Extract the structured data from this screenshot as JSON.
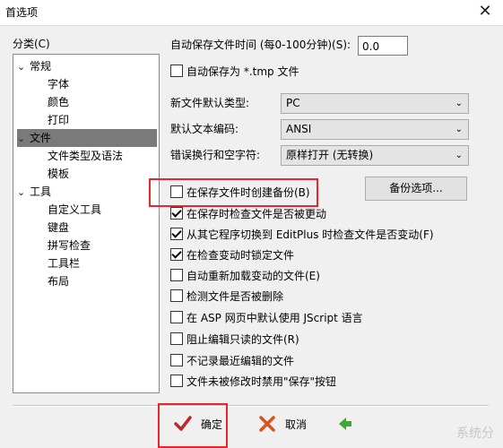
{
  "window": {
    "title": "首选项",
    "close_glyph": "✕"
  },
  "category": {
    "label": "分类(C)",
    "items": [
      {
        "label": "常规",
        "expanded": true
      },
      {
        "label": "字体"
      },
      {
        "label": "颜色"
      },
      {
        "label": "打印"
      },
      {
        "label": "文件",
        "expanded": true,
        "selected": true
      },
      {
        "label": "文件类型及语法"
      },
      {
        "label": "模板"
      },
      {
        "label": "工具",
        "expanded": true
      },
      {
        "label": "自定义工具"
      },
      {
        "label": "键盘"
      },
      {
        "label": "拼写检查"
      },
      {
        "label": "工具栏"
      },
      {
        "label": "布局"
      }
    ]
  },
  "autosave": {
    "label": "自动保存文件时间 (每0-100分钟)(S):",
    "value": "0.0"
  },
  "checkbox_tmp": {
    "label": "自动保存为 *.tmp 文件",
    "checked": false
  },
  "new_file_type": {
    "label": "新文件默认类型:",
    "value": "PC"
  },
  "default_encoding": {
    "label": "默认文本编码:",
    "value": "ANSI"
  },
  "wrap_whitespace": {
    "label": "错误换行和空字符:",
    "value": "原样打开 (无转换)"
  },
  "backup_options_button": "备份选项...",
  "checkboxes": [
    {
      "label": "在保存文件时创建备份(B)",
      "checked": false
    },
    {
      "label": "在保存时检查文件是否被更动",
      "checked": true
    },
    {
      "label": "从其它程序切换到 EditPlus 时检查文件是否变动(F)",
      "checked": true
    },
    {
      "label": "在检查变动时锁定文件",
      "checked": true
    },
    {
      "label": "自动重新加载变动的文件(E)",
      "checked": false
    },
    {
      "label": "检测文件是否被删除",
      "checked": false
    },
    {
      "label": "在 ASP 网页中默认使用 JScript 语言",
      "checked": false
    },
    {
      "label": "阻止编辑只读的文件(R)",
      "checked": false
    },
    {
      "label": "不记录最近编辑的文件",
      "checked": false
    },
    {
      "label": "文件未被修改时禁用\"保存\"按钮",
      "checked": false
    }
  ],
  "buttons": {
    "ok": "确定",
    "cancel": "取消"
  },
  "colors": {
    "highlight": "#e8262b",
    "ok_check": "#c0272d",
    "cancel_x": "#d9531e",
    "apply_arrow": "#3aa935"
  },
  "watermark": "系统分"
}
